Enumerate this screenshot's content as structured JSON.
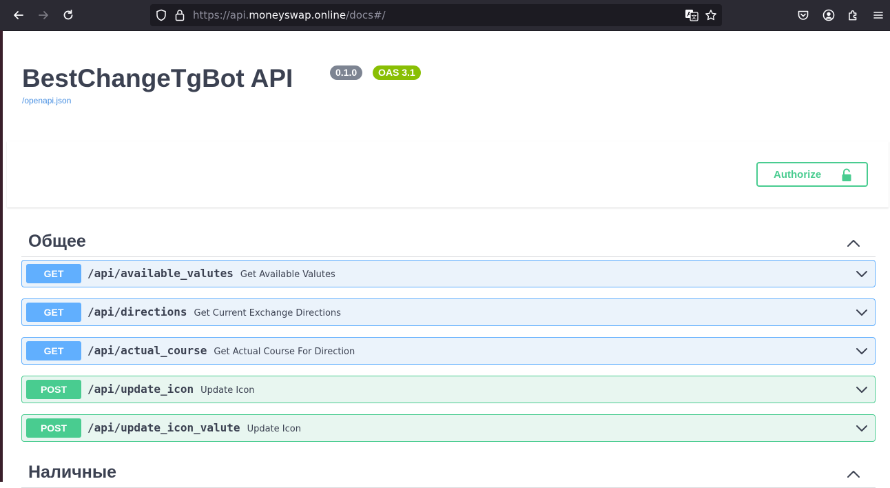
{
  "browser": {
    "url_prefix": "https://api.",
    "url_host": "moneyswap.online",
    "url_path": "/docs#/"
  },
  "info": {
    "title": "BestChangeTgBot API",
    "version": "0.1.0",
    "oas": "OAS 3.1",
    "spec_link": "/openapi.json"
  },
  "auth": {
    "label": "Authorize"
  },
  "tags": [
    {
      "name": "Общее",
      "operations": [
        {
          "method": "GET",
          "path": "/api/available_valutes",
          "summary": "Get Available Valutes"
        },
        {
          "method": "GET",
          "path": "/api/directions",
          "summary": "Get Current Exchange Directions"
        },
        {
          "method": "GET",
          "path": "/api/actual_course",
          "summary": "Get Actual Course For Direction"
        },
        {
          "method": "POST",
          "path": "/api/update_icon",
          "summary": "Update Icon"
        },
        {
          "method": "POST",
          "path": "/api/update_icon_valute",
          "summary": "Update Icon"
        }
      ]
    },
    {
      "name": "Наличные",
      "operations": []
    }
  ],
  "colors": {
    "get": "#61affe",
    "post": "#49cc90",
    "version_badge": "#7d8492",
    "oas_badge": "#89bf04"
  }
}
